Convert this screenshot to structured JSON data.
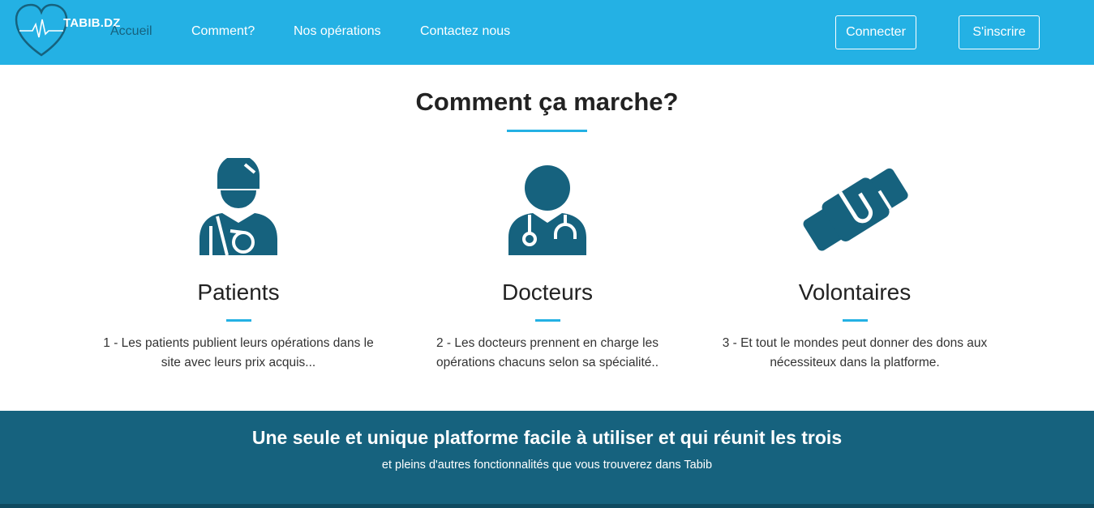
{
  "brand": {
    "name": "TABIB.DZ"
  },
  "nav": {
    "links": [
      "Accueil",
      "Comment?",
      "Nos opérations",
      "Contactez nous"
    ],
    "connect_label": "Connecter",
    "signup_label": "S'inscrire"
  },
  "how": {
    "title": "Comment ça marche?",
    "features": [
      {
        "icon": "injured-patient-icon",
        "title": "Patients",
        "desc_line1": "1 - Les patients publient leurs opérations dans le",
        "desc_line2": "site avec leurs prix acquis..."
      },
      {
        "icon": "doctor-icon",
        "title": "Docteurs",
        "desc_line1": "2 - Les docteurs prennent en charge les",
        "desc_line2": "opérations chacuns selon sa spécialité.."
      },
      {
        "icon": "handshake-icon",
        "title": "Volontaires",
        "desc_line1": "3 - Et tout le mondes peut donner des dons aux",
        "desc_line2": "nécessiteux dans la platforme."
      }
    ]
  },
  "banner": {
    "title": "Une seule et unique platforme facile à utiliser et qui réunit les trois",
    "subtitle": "et pleins d'autres fonctionnalités que vous trouverez dans Tabib"
  },
  "colors": {
    "primary": "#24b1e4",
    "dark": "#16627e",
    "active_link": "#16627e"
  }
}
